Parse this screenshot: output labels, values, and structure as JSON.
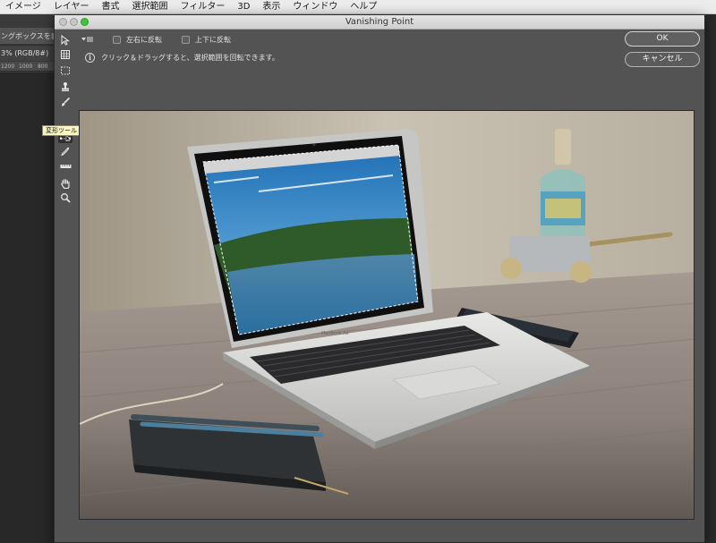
{
  "menubar": {
    "items": [
      "イメージ",
      "レイヤー",
      "書式",
      "選択範囲",
      "フィルター",
      "3D",
      "表示",
      "ウィンドウ",
      "ヘルプ"
    ]
  },
  "photoshop": {
    "options_fragment": "ングボックスを表示",
    "doc_tab_fragment": "3% (RGB/8#)",
    "ruler_labels": [
      "1200",
      "1000",
      "800"
    ]
  },
  "dialog": {
    "title": "Vanishing Point",
    "flip_horizontal_label": "左右に反転",
    "flip_vertical_label": "上下に反転",
    "info_text": "クリック＆ドラッグすると、選択範囲を回転できます。",
    "ok_label": "OK",
    "cancel_label": "キャンセル",
    "tooltip": "変形ツール (T)",
    "laptop_brand": "MacBook Air"
  },
  "tools": [
    {
      "name": "edit-plane-tool",
      "icon": "arrow-icon"
    },
    {
      "name": "create-plane-tool",
      "icon": "grid-icon"
    },
    {
      "name": "marquee-tool",
      "icon": "marquee-icon"
    },
    {
      "name": "stamp-tool",
      "icon": "stamp-icon"
    },
    {
      "name": "brush-tool",
      "icon": "brush-icon"
    },
    {
      "name": "transform-tool",
      "icon": "transform-icon",
      "active": true
    },
    {
      "name": "eyedropper-tool",
      "icon": "eyedropper-icon"
    },
    {
      "name": "measure-tool",
      "icon": "ruler-icon"
    },
    {
      "name": "hand-tool",
      "icon": "hand-icon"
    },
    {
      "name": "zoom-tool",
      "icon": "zoom-icon"
    }
  ],
  "colors": {
    "dialog_bg": "#535353",
    "tooltip_bg": "#fbf6c4",
    "zoom_button": "#3fc23d"
  }
}
